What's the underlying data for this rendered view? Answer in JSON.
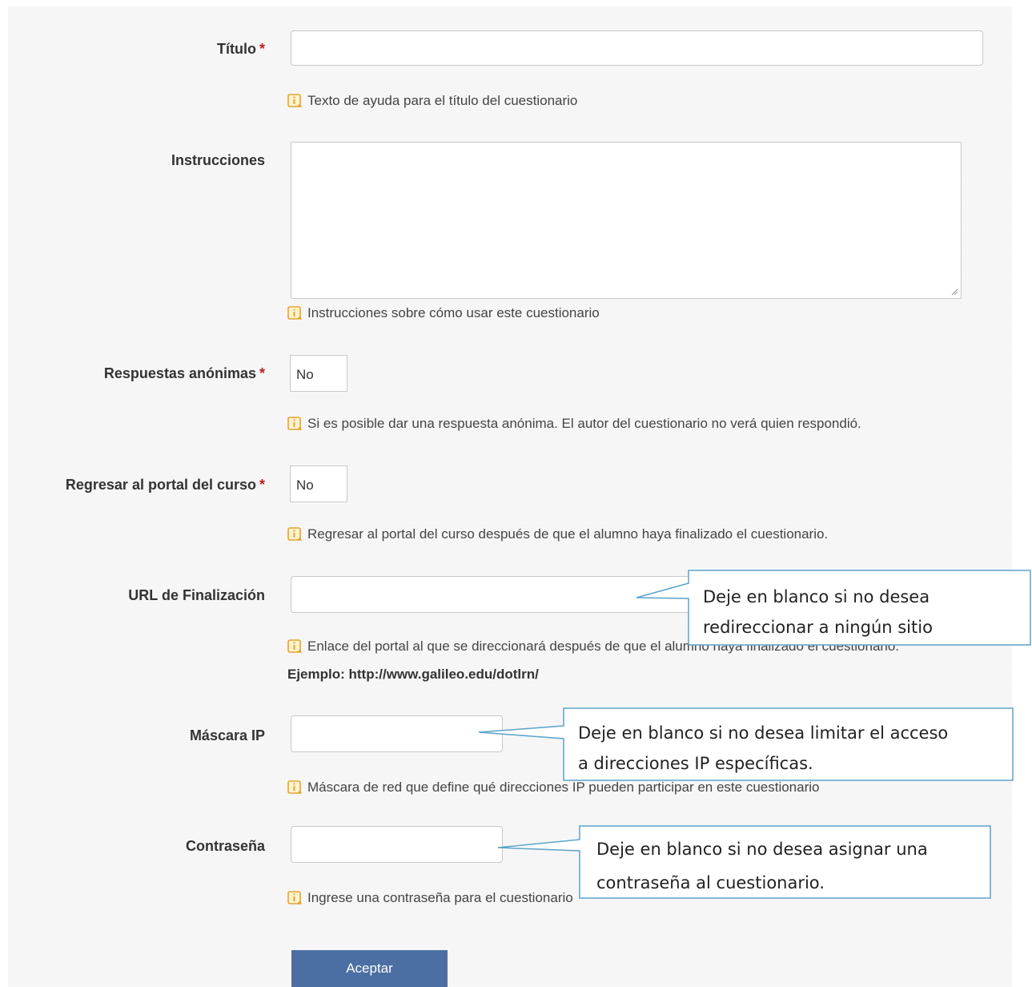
{
  "form": {
    "titulo": {
      "label": "Título",
      "required": "*",
      "help": "Texto de ayuda para el título del cuestionario",
      "value": ""
    },
    "instrucciones": {
      "label": "Instrucciones",
      "help": "Instrucciones sobre cómo usar este cuestionario",
      "value": ""
    },
    "respuestas_anonimas": {
      "label": "Respuestas anónimas",
      "required": "*",
      "value": "No",
      "help": "Si es posible dar una respuesta anónima. El autor del cuestionario no verá quien respondió."
    },
    "regresar_portal": {
      "label": "Regresar al portal del curso",
      "required": "*",
      "value": "No",
      "help": "Regresar al portal del curso después de que el alumno haya finalizado el cuestionario."
    },
    "url_finalizacion": {
      "label": "URL de Finalización",
      "value": "",
      "help": "Enlace del portal al que se direccionará después de que el alumno haya finalizado el cuestionario.",
      "example": "Ejemplo: http://www.galileo.edu/dotlrn/"
    },
    "mascara_ip": {
      "label": "Máscara IP",
      "value": "",
      "help": "Máscara de red que define qué direcciones IP pueden participar en este cuestionario"
    },
    "contrasena": {
      "label": "Contraseña",
      "value": "",
      "help": "Ingrese una contraseña para el cuestionario"
    },
    "submit_label": "Aceptar"
  },
  "callouts": {
    "url": {
      "line1": "Deje en blanco si no desea",
      "line2": "redireccionar a ningún sitio"
    },
    "ip": {
      "line1": "Deje en blanco si no desea limitar el acceso",
      "line2": "a direcciones IP específicas."
    },
    "password": {
      "line1": "Deje en blanco si no desea asignar una",
      "line2": "contraseña al cuestionario."
    }
  },
  "colors": {
    "accent": "#4b6fa3",
    "required": "#b22222",
    "callout_border": "#5ba3c9",
    "info_icon": "#e6a32e"
  },
  "icons": {
    "info": "info-icon",
    "resize": "resize-grip-icon"
  }
}
